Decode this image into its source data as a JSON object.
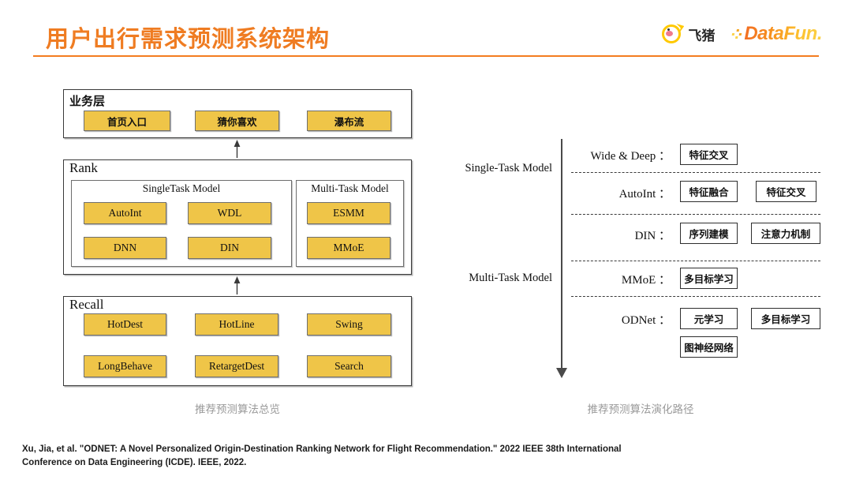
{
  "header": {
    "title": "用户出行需求预测系统架构",
    "accent_color": "#ef7c22",
    "rule_color": "#f47c20",
    "logos": {
      "fliggy": {
        "name": "fliggy-logo",
        "wordmark": "飞猪"
      },
      "datafun": {
        "name": "datafun-logo",
        "wordmark": "DataFun."
      }
    }
  },
  "left_diagram": {
    "caption": "推荐预测算法总览",
    "box_color": "#efc548",
    "layers": [
      {
        "label": "业务层",
        "items": [
          {
            "label": "首页入口"
          },
          {
            "label": "猜你喜欢"
          },
          {
            "label": "瀑布流"
          }
        ]
      },
      {
        "label": "Rank",
        "groups": [
          {
            "title": "SingleTask Model",
            "items": [
              {
                "label": "AutoInt"
              },
              {
                "label": "WDL"
              },
              {
                "label": "DNN"
              },
              {
                "label": "DIN"
              }
            ]
          },
          {
            "title": "Multi-Task Model",
            "items": [
              {
                "label": "ESMM"
              },
              {
                "label": "MMoE"
              }
            ]
          }
        ]
      },
      {
        "label": "Recall",
        "items": [
          {
            "label": "HotDest"
          },
          {
            "label": "HotLine"
          },
          {
            "label": "Swing"
          },
          {
            "label": "LongBehave"
          },
          {
            "label": "RetargetDest"
          },
          {
            "label": "Search"
          }
        ]
      }
    ]
  },
  "right_diagram": {
    "caption": "推荐预测算法演化路径",
    "axis_groups": [
      {
        "label": "Single-Task Model"
      },
      {
        "label": "Multi-Task Model"
      }
    ],
    "rows": [
      {
        "label": "Wide & Deep ：",
        "tags": [
          "特征交叉"
        ]
      },
      {
        "label": "AutoInt ：",
        "tags": [
          "特征融合",
          "特征交叉"
        ]
      },
      {
        "label": "DIN ：",
        "tags": [
          "序列建模",
          "注意力机制"
        ]
      },
      {
        "label": "MMoE ：",
        "tags": [
          "多目标学习"
        ]
      },
      {
        "label": "ODNet ：",
        "tags": [
          "元学习",
          "多目标学习",
          "图神经网络"
        ]
      }
    ]
  },
  "footer": {
    "citation": "Xu, Jia, et al. \"ODNET: A Novel Personalized Origin-Destination Ranking Network for Flight Recommendation.\" 2022 IEEE 38th International Conference on Data Engineering (ICDE). IEEE, 2022."
  }
}
